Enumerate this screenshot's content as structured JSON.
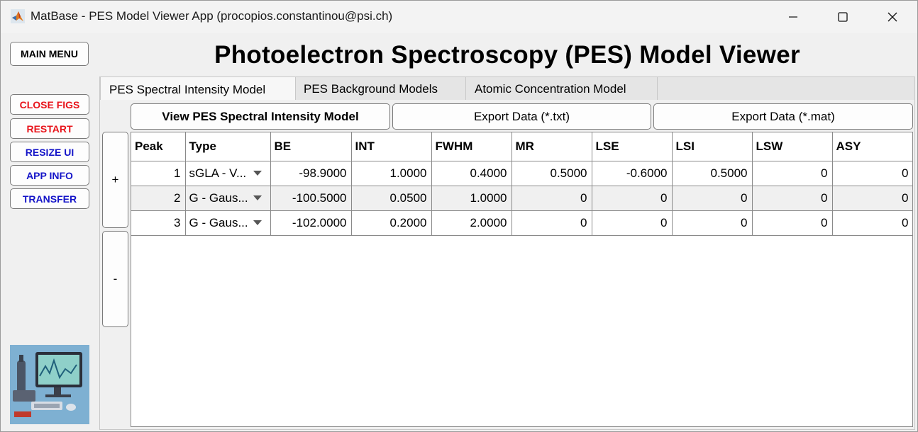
{
  "window": {
    "title": "MatBase - PES Model Viewer App (procopios.constantinou@psi.ch)"
  },
  "sidebar": {
    "main_menu": "MAIN MENU",
    "close_figs": "CLOSE FIGS",
    "restart": "RESTART",
    "resize_ui": "RESIZE UI",
    "app_info": "APP INFO",
    "transfer": "TRANSFER"
  },
  "header": {
    "title": "Photoelectron Spectroscopy (PES) Model Viewer"
  },
  "tabs": [
    {
      "label": "PES Spectral Intensity Model"
    },
    {
      "label": "PES Background Models"
    },
    {
      "label": "Atomic Concentration Model"
    }
  ],
  "toolbar": {
    "view_label": "View PES Spectral Intensity Model",
    "export_txt": "Export Data (*.txt)",
    "export_mat": "Export Data (*.mat)",
    "add_label": "+",
    "remove_label": "-"
  },
  "table": {
    "columns": [
      "Peak",
      "Type",
      "BE",
      "INT",
      "FWHM",
      "MR",
      "LSE",
      "LSI",
      "LSW",
      "ASY"
    ],
    "rows": [
      {
        "peak": "1",
        "type": "sGLA - V...",
        "be": "-98.9000",
        "int": "1.0000",
        "fwhm": "0.4000",
        "mr": "0.5000",
        "lse": "-0.6000",
        "lsi": "0.5000",
        "lsw": "0",
        "asy": "0"
      },
      {
        "peak": "2",
        "type": "G - Gaus...",
        "be": "-100.5000",
        "int": "0.0500",
        "fwhm": "1.0000",
        "mr": "0",
        "lse": "0",
        "lsi": "0",
        "lsw": "0",
        "asy": "0"
      },
      {
        "peak": "3",
        "type": "G - Gaus...",
        "be": "-102.0000",
        "int": "0.2000",
        "fwhm": "2.0000",
        "mr": "0",
        "lse": "0",
        "lsi": "0",
        "lsw": "0",
        "asy": "0"
      }
    ]
  },
  "icons": {
    "app": "matlab-icon",
    "minimize": "minimize-icon",
    "maximize": "maximize-icon",
    "close": "close-icon",
    "dropdown": "chevron-down-icon"
  },
  "colors": {
    "danger_text": "#e8141b",
    "info_text": "#1414c8"
  }
}
